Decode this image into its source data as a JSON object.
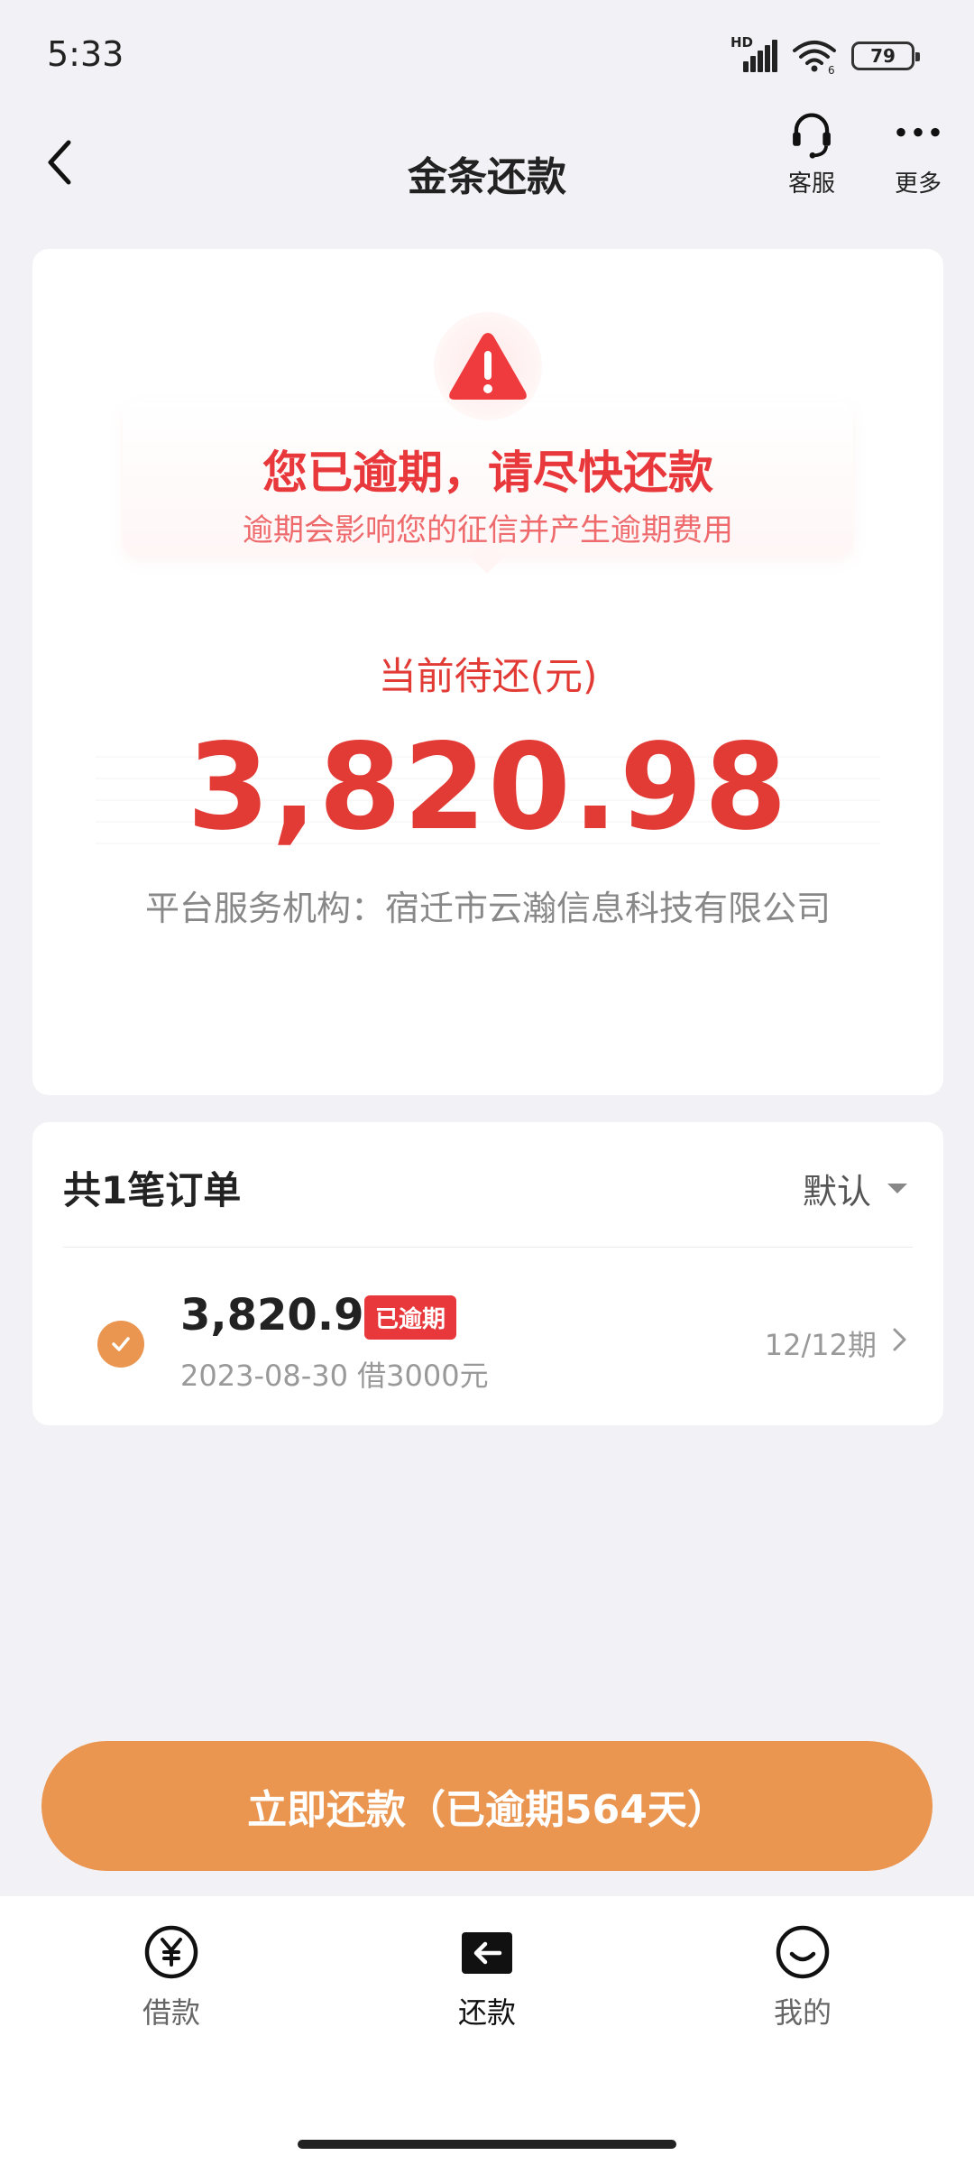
{
  "status_bar": {
    "time": "5:33",
    "network_label": "HD",
    "wifi_sub": "6",
    "battery": "79",
    "icons": [
      "signal-icon",
      "wifi-icon",
      "battery-icon"
    ]
  },
  "nav": {
    "title": "金条还款",
    "service_label": "客服",
    "more_label": "更多",
    "icons": [
      "back-arrow-icon",
      "headset-icon",
      "more-dots-icon"
    ]
  },
  "overdue": {
    "title": "您已逾期，请尽快还款",
    "subtitle": "逾期会影响您的征信并产生逾期费用",
    "due_label": "当前待还(元)",
    "due_amount": "3,820.98",
    "platform": "平台服务机构：宿迁市云瀚信息科技有限公司",
    "icon": "warning-triangle-icon"
  },
  "orders": {
    "count_label": "共1笔订单",
    "sort_label": "默认",
    "items": [
      {
        "amount": "3,820.98",
        "badge": "已逾期",
        "sub": "2023-08-30 借3000元",
        "term": "12/12期"
      }
    ]
  },
  "pay_button": {
    "label": "立即还款（已逾期564天）"
  },
  "tabs": [
    {
      "label": "借款",
      "icon": "yen-circle-icon",
      "active": false
    },
    {
      "label": "还款",
      "icon": "repay-arrow-icon",
      "active": true
    },
    {
      "label": "我的",
      "icon": "smile-icon",
      "active": false
    }
  ],
  "colors": {
    "accent": "#ea9550",
    "danger": "#e23b36",
    "background": "#f2f2f6"
  }
}
